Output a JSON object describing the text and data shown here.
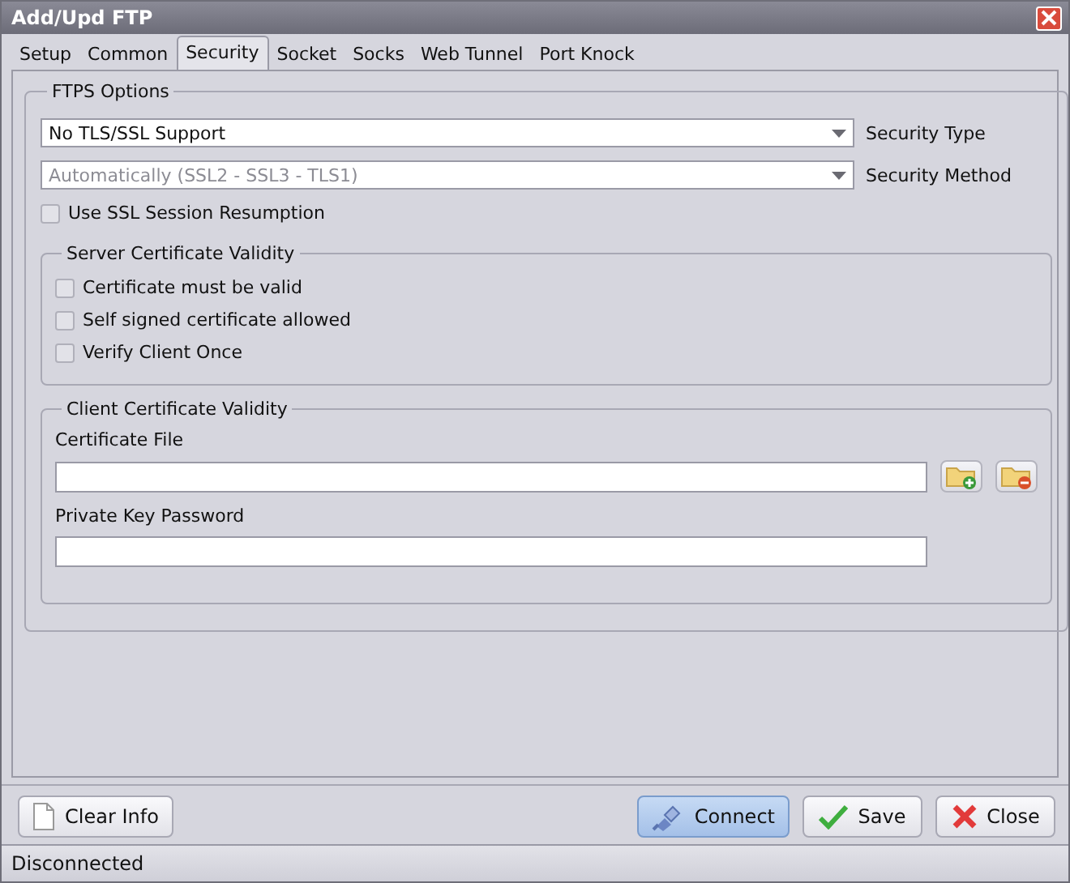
{
  "window": {
    "title": "Add/Upd FTP"
  },
  "tabs": [
    {
      "label": "Setup",
      "selected": false
    },
    {
      "label": "Common",
      "selected": false
    },
    {
      "label": "Security",
      "selected": true
    },
    {
      "label": "Socket",
      "selected": false
    },
    {
      "label": "Socks",
      "selected": false
    },
    {
      "label": "Web Tunnel",
      "selected": false
    },
    {
      "label": "Port Knock",
      "selected": false
    }
  ],
  "ftps_options": {
    "title": "FTPS Options",
    "dropdowns": [
      {
        "value": "No TLS/SSL Support",
        "label": "Security Type",
        "disabled": false
      },
      {
        "value": "Automatically (SSL2 - SSL3 - TLS1)",
        "label": "Security Method",
        "disabled": true
      }
    ],
    "session_resumption": {
      "label": "Use SSL Session Resumption",
      "checked": false
    },
    "server_certificate": {
      "title": "Server Certificate Validity",
      "options": [
        {
          "label": "Certificate must be valid",
          "checked": false
        },
        {
          "label": "Self signed certificate allowed",
          "checked": false
        },
        {
          "label": "Verify Client Once",
          "checked": false
        }
      ]
    },
    "client_certificate": {
      "title": "Client Certificate Validity",
      "certificate_file_label": "Certificate File",
      "private_key_label": "Private Key Password"
    }
  },
  "buttons": [
    {
      "label": "Clear Info",
      "kind": "clear",
      "default": false
    },
    {
      "label": "Connect",
      "kind": "connect",
      "default": true
    },
    {
      "label": "Save",
      "kind": "save",
      "default": false
    },
    {
      "label": "Close",
      "kind": "close",
      "default": false
    }
  ],
  "status_bar": {
    "text": "Disconnected"
  }
}
